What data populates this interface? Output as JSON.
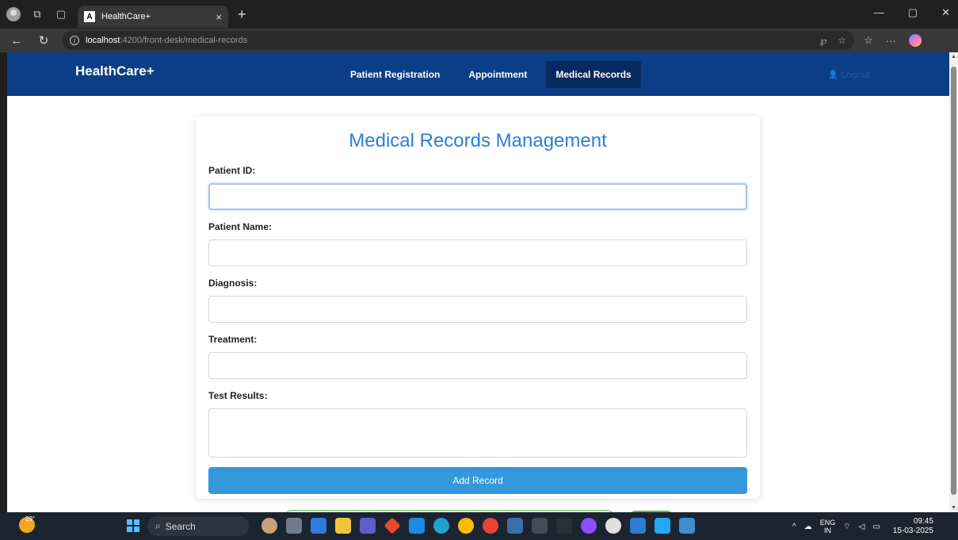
{
  "browser": {
    "tab_title": "HealthCare+",
    "tab_favicon": "A",
    "url_host": "localhost",
    "url_path": ":4200/front-desk/medical-records"
  },
  "app": {
    "brand": "HealthCare+",
    "nav": [
      {
        "label": "Patient Registration",
        "active": false
      },
      {
        "label": "Appointment",
        "active": false
      },
      {
        "label": "Medical Records",
        "active": true
      }
    ],
    "logout": "Logout"
  },
  "form": {
    "title": "Medical Records Management",
    "fields": {
      "patient_id": {
        "label": "Patient ID:",
        "value": ""
      },
      "patient_name": {
        "label": "Patient Name:",
        "value": ""
      },
      "diagnosis": {
        "label": "Diagnosis:",
        "value": ""
      },
      "treatment": {
        "label": "Treatment:",
        "value": ""
      },
      "test_results": {
        "label": "Test Results:",
        "value": ""
      }
    },
    "submit_label": "Add Record"
  },
  "taskbar": {
    "weather_temp": "29°",
    "search_placeholder": "Search",
    "language": "ENG",
    "region": "IN",
    "time": "09:45",
    "date": "15-03-2025"
  },
  "colors": {
    "navbar": "#0b3e86",
    "active_nav": "#092a5d",
    "title": "#2a7fd4",
    "button": "#3498db"
  }
}
